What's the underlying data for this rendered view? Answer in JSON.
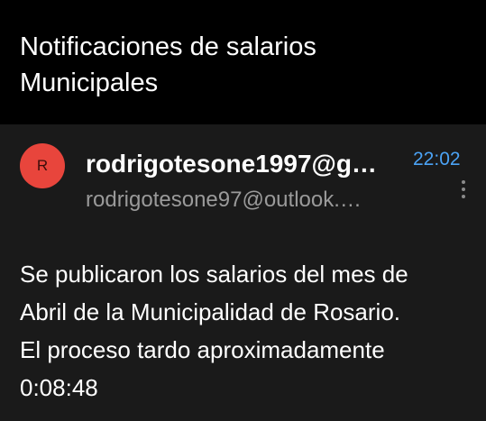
{
  "thread": {
    "subject_line1": "Notificaciones de salarios",
    "subject_line2": "Municipales"
  },
  "message": {
    "avatar_letter": "R",
    "avatar_color": "#e8453c",
    "sender": "rodrigotesone1997@g…",
    "recipient": "rodrigotesone97@outlook.…",
    "time": "22:02",
    "time_color": "#4ba3f5",
    "more_icon": "more-vert-icon",
    "body_lines": [
      "Se publicaron los salarios del mes de",
      "Abril de la Municipalidad de Rosario.",
      "El proceso tardo aproximadamente",
      "0:08:48"
    ]
  }
}
